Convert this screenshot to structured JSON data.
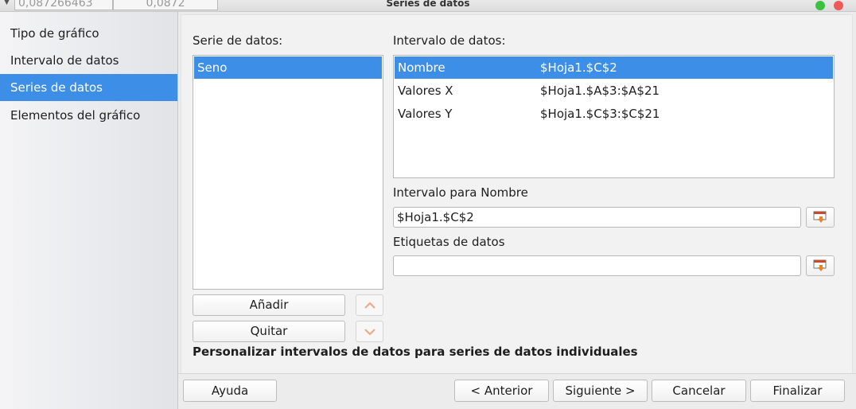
{
  "window": {
    "title": "Series de datos",
    "background_cells": [
      "0,087266463",
      "0,0872"
    ]
  },
  "sidebar": {
    "items": [
      {
        "label": "Tipo de gráfico",
        "active": false
      },
      {
        "label": "Intervalo de datos",
        "active": false
      },
      {
        "label": "Series de datos",
        "active": true
      },
      {
        "label": "Elementos del gráfico",
        "active": false
      }
    ]
  },
  "series_panel": {
    "label": "Serie de datos:",
    "items": [
      "Seno"
    ],
    "selected": "Seno",
    "add_button": "Añadir",
    "remove_button": "Quitar"
  },
  "ranges_panel": {
    "label": "Intervalo de datos:",
    "rows": [
      {
        "role": "Nombre",
        "range": "$Hoja1.$C$2",
        "selected": true
      },
      {
        "role": "Valores X",
        "range": "$Hoja1.$A$3:$A$21",
        "selected": false
      },
      {
        "role": "Valores Y",
        "range": "$Hoja1.$C$3:$C$21",
        "selected": false
      }
    ],
    "name_range_label": "Intervalo para Nombre",
    "name_range_value": "$Hoja1.$C$2",
    "data_labels_label": "Etiquetas de datos",
    "data_labels_value": ""
  },
  "hint": "Personalizar intervalos de datos para series de datos individuales",
  "footer": {
    "help": "Ayuda",
    "back": "< Anterior",
    "next": "Siguiente >",
    "cancel": "Cancelar",
    "finish": "Finalizar"
  },
  "colors": {
    "accent": "#3d8ee6",
    "traffic_green": "#3cc23c",
    "traffic_red": "#ee5a5a"
  }
}
